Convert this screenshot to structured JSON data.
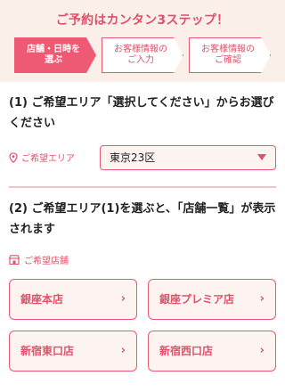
{
  "header": {
    "title": "ご予約はカンタン3ステップ！",
    "steps": [
      {
        "label": "店舗・日時を\n選ぶ",
        "active": true
      },
      {
        "label": "お客様情報の\nご入力",
        "active": false
      },
      {
        "label": "お客様情報の\nご確認",
        "active": false
      }
    ]
  },
  "section1": {
    "question": "(1) ご希望エリア「選択してください」からお選びください",
    "area_label": "ご希望エリア",
    "select_value": "東京23区"
  },
  "section2": {
    "question": "(2) ご希望エリア(1)を選ぶと、「店舗一覧」が表示されます",
    "store_label": "ご希望店舗",
    "stores": [
      "銀座本店",
      "銀座プレミア店",
      "新宿東口店",
      "新宿西口店"
    ]
  },
  "colors": {
    "accent": "#e0506a",
    "background_top": "#fbefe9"
  }
}
